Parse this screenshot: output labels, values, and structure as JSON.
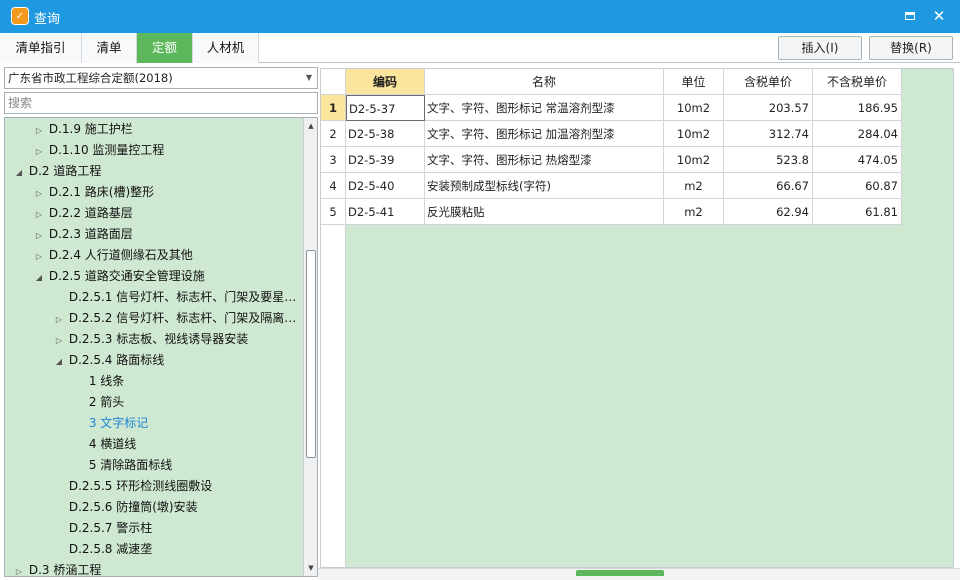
{
  "window": {
    "title": "查询",
    "app_icon": "app-logo-icon",
    "maximize_icon": "maximize-icon",
    "close_icon": "close-icon",
    "close_symbol": "✕"
  },
  "tabs": [
    {
      "label": "清单指引",
      "active": false
    },
    {
      "label": "清单",
      "active": false
    },
    {
      "label": "定额",
      "active": true
    },
    {
      "label": "人材机",
      "active": false
    }
  ],
  "toolbar": {
    "insert_label": "插入(I)",
    "replace_label": "替换(R)"
  },
  "left_panel": {
    "quota_library": "广东省市政工程综合定额(2018)",
    "search_placeholder": "搜索",
    "tree": [
      {
        "label": "D.1.9 施工护栏",
        "toggle": "▷",
        "depth": 1
      },
      {
        "label": "D.1.10 监测量控工程",
        "toggle": "▷",
        "depth": 1
      },
      {
        "label": "D.2 道路工程",
        "toggle": "◢",
        "depth": 0
      },
      {
        "label": "D.2.1 路床(槽)整形",
        "toggle": "▷",
        "depth": 1
      },
      {
        "label": "D.2.2 道路基层",
        "toggle": "▷",
        "depth": 1
      },
      {
        "label": "D.2.3 道路面层",
        "toggle": "▷",
        "depth": 1
      },
      {
        "label": "D.2.4 人行道侧缘石及其他",
        "toggle": "▷",
        "depth": 1
      },
      {
        "label": "D.2.5 道路交通安全管理设施",
        "toggle": "◢",
        "depth": 1
      },
      {
        "label": "D.2.5.1 信号灯杆、标志杆、门架及要星…",
        "toggle": "",
        "depth": 2
      },
      {
        "label": "D.2.5.2 信号灯杆、标志杆、门架及隔离…",
        "toggle": "▷",
        "depth": 2
      },
      {
        "label": "D.2.5.3 标志板、视线诱导器安装",
        "toggle": "▷",
        "depth": 2
      },
      {
        "label": "D.2.5.4 路面标线",
        "toggle": "◢",
        "depth": 2
      },
      {
        "label": "1 线条",
        "toggle": "",
        "depth": 3
      },
      {
        "label": "2 箭头",
        "toggle": "",
        "depth": 3
      },
      {
        "label": "3 文字标记",
        "toggle": "",
        "depth": 3,
        "selected": true
      },
      {
        "label": "4 横道线",
        "toggle": "",
        "depth": 3
      },
      {
        "label": "5 清除路面标线",
        "toggle": "",
        "depth": 3
      },
      {
        "label": "D.2.5.5 环形检测线圈敷设",
        "toggle": "",
        "depth": 2
      },
      {
        "label": "D.2.5.6 防撞筒(墩)安装",
        "toggle": "",
        "depth": 2
      },
      {
        "label": "D.2.5.7 警示柱",
        "toggle": "",
        "depth": 2
      },
      {
        "label": "D.2.5.8 减速垄",
        "toggle": "",
        "depth": 2
      },
      {
        "label": "D.3 桥涵工程",
        "toggle": "▷",
        "depth": 0
      }
    ]
  },
  "grid": {
    "columns": [
      "编码",
      "名称",
      "单位",
      "含税单价",
      "不含税单价"
    ],
    "rows": [
      {
        "num": "1",
        "code": "D2-5-37",
        "name": "文字、字符、图形标记 常温溶剂型漆",
        "unit": "10m2",
        "price_tax": "203.57",
        "price_notax": "186.95"
      },
      {
        "num": "2",
        "code": "D2-5-38",
        "name": "文字、字符、图形标记 加温溶剂型漆",
        "unit": "10m2",
        "price_tax": "312.74",
        "price_notax": "284.04"
      },
      {
        "num": "3",
        "code": "D2-5-39",
        "name": "文字、字符、图形标记 热熔型漆",
        "unit": "10m2",
        "price_tax": "523.8",
        "price_notax": "474.05"
      },
      {
        "num": "4",
        "code": "D2-5-40",
        "name": "安装预制成型标线(字符)",
        "unit": "m2",
        "price_tax": "66.67",
        "price_notax": "60.87"
      },
      {
        "num": "5",
        "code": "D2-5-41",
        "name": "反光膜粘贴",
        "unit": "m2",
        "price_tax": "62.94",
        "price_notax": "61.81"
      }
    ]
  },
  "colors": {
    "title_bar": "#1e98e0",
    "active_tab": "#5db85c",
    "panel_bg": "#cfe8d2",
    "selected_text": "#1f84d6",
    "header_highlight": "#fbe49b"
  }
}
